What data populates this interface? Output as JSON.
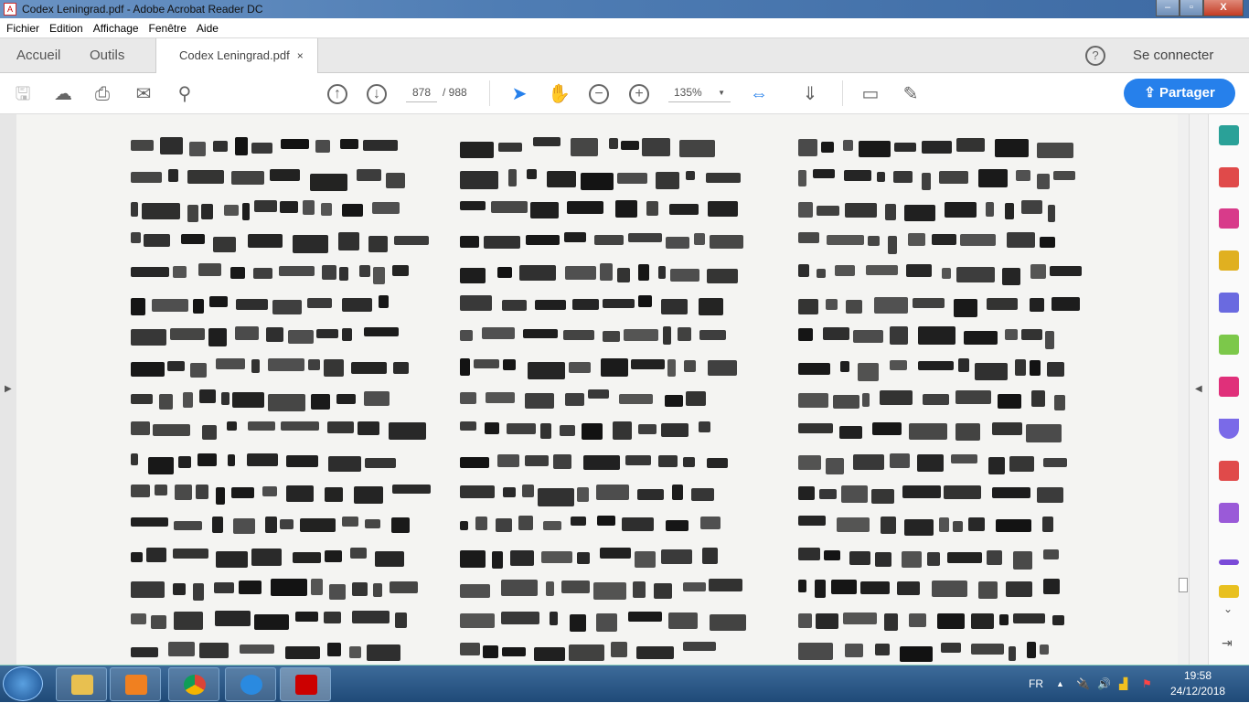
{
  "window": {
    "title": "Codex Leningrad.pdf - Adobe Acrobat Reader DC",
    "minimize": "–",
    "maximize": "▫",
    "close": "X"
  },
  "menu": [
    "Fichier",
    "Edition",
    "Affichage",
    "Fenêtre",
    "Aide"
  ],
  "tabs": {
    "home": "Accueil",
    "tools": "Outils",
    "document": "Codex Leningrad.pdf",
    "close": "×",
    "help": "?",
    "signin": "Se connecter"
  },
  "toolbar": {
    "current_page": "878",
    "total_pages": "/ 988",
    "zoom": "135%",
    "share": "Partager"
  },
  "taskbar": {
    "language": "FR",
    "time": "19:58",
    "date": "24/12/2018"
  },
  "colors": {
    "accent": "#2680eb",
    "titlebar": "#4f7db4"
  }
}
